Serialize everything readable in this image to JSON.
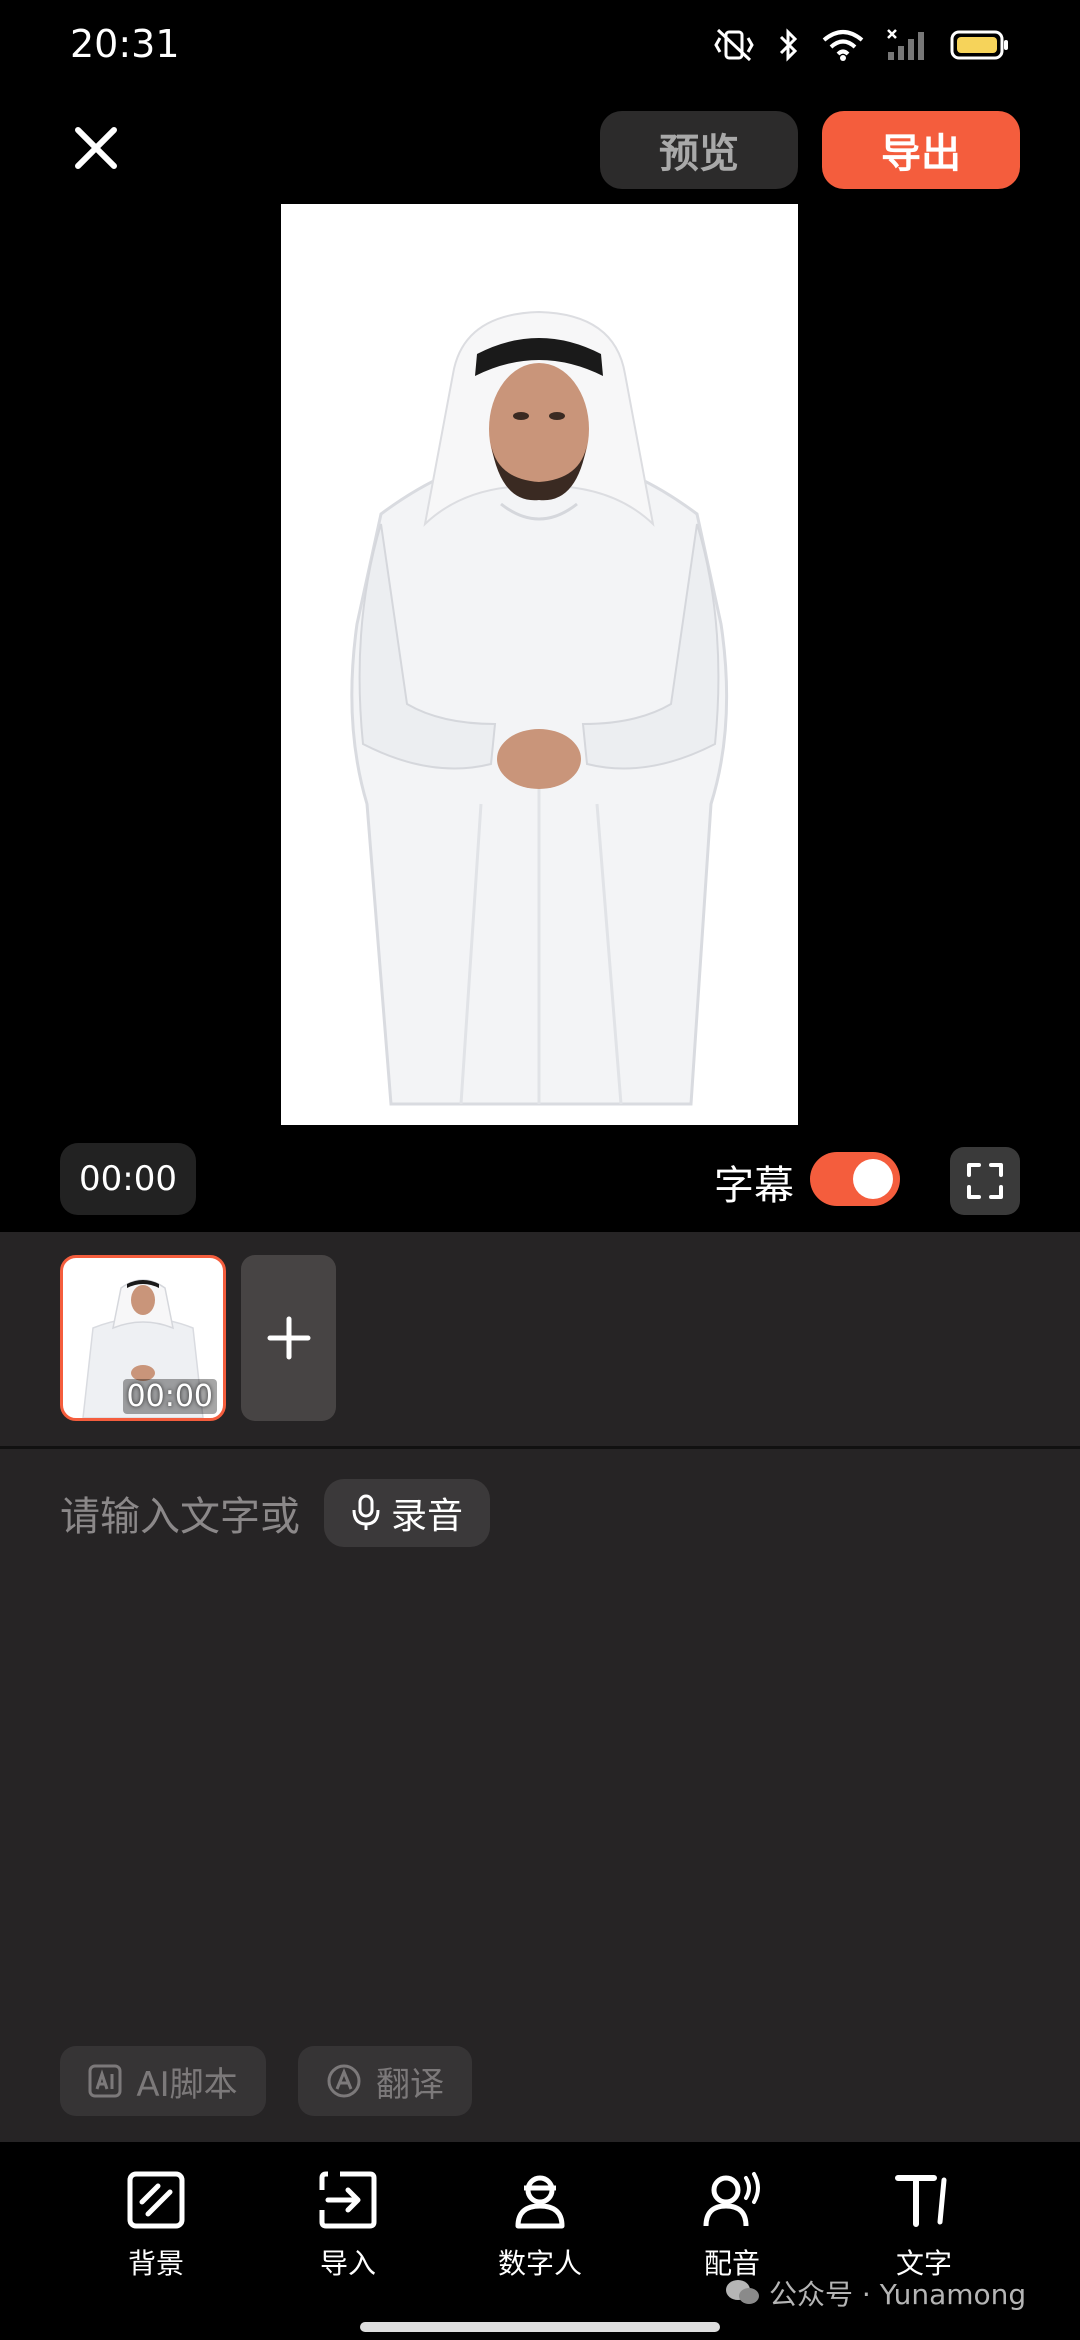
{
  "status_bar": {
    "time": "20:31",
    "icons": [
      "vibrate-off-icon",
      "bluetooth-icon",
      "wifi-icon",
      "signal-icon",
      "battery-icon"
    ]
  },
  "top_bar": {
    "preview_label": "预览",
    "export_label": "导出"
  },
  "colors": {
    "accent": "#f45d3d",
    "panel_bg": "#262425",
    "button_dark": "#2c2b2b"
  },
  "preview": {
    "time": "00:00",
    "subtitle_label": "字幕",
    "subtitle_enabled": true
  },
  "clips": {
    "items": [
      {
        "time": "00:00"
      }
    ]
  },
  "script_input": {
    "placeholder": "请输入文字或",
    "record_label": "录音"
  },
  "actions": {
    "ai_script_label": "AI脚本",
    "translate_label": "翻译"
  },
  "toolbar": {
    "items": [
      {
        "label": "背景",
        "icon": "background-icon"
      },
      {
        "label": "导入",
        "icon": "import-icon"
      },
      {
        "label": "数字人",
        "icon": "digital-human-icon"
      },
      {
        "label": "配音",
        "icon": "dubbing-icon"
      },
      {
        "label": "文字",
        "icon": "text-icon"
      }
    ]
  },
  "watermark": "公众号 · Yunamong"
}
